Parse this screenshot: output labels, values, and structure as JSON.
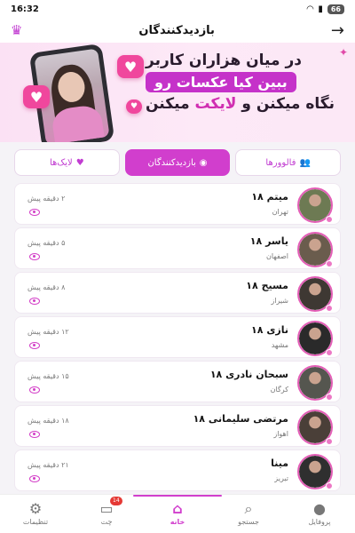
{
  "status_bar": {
    "time": "16:32",
    "battery": "66"
  },
  "app_bar": {
    "title": "بازدیدکنندگان"
  },
  "banner": {
    "line1": "در میان هزاران کاربر",
    "line2": "ببین کیا عکسات رو",
    "line3_prefix": "نگاه میکنن و",
    "line3_highlight": "لایکت",
    "line3_suffix": "میکنن"
  },
  "tabs": [
    {
      "label": "فالوورها",
      "icon": "users-icon"
    },
    {
      "label": "بازدیدکنندگان",
      "icon": "eye-icon"
    },
    {
      "label": "لایک‌ها",
      "icon": "heart-icon"
    }
  ],
  "visitors": [
    {
      "name": "میتم ۱۸",
      "city": "تهران",
      "time": "۲ دقیقه پیش",
      "avatar_color": "#6d7a53"
    },
    {
      "name": "یاسر ۱۸",
      "city": "اصفهان",
      "time": "۵ دقیقه پیش",
      "avatar_color": "#6a5c4d"
    },
    {
      "name": "مسیح ۱۸",
      "city": "شیراز",
      "time": "۸ دقیقه پیش",
      "avatar_color": "#3e3833"
    },
    {
      "name": "نازی ۱۸",
      "city": "مشهد",
      "time": "۱۲ دقیقه پیش",
      "avatar_color": "#2a2a2a"
    },
    {
      "name": "سبحان نادری ۱۸",
      "city": "کرگان",
      "time": "۱۵ دقیقه پیش",
      "avatar_color": "#55564f"
    },
    {
      "name": "مرتضی سلیمانی ۱۸",
      "city": "اهواز",
      "time": "۱۸ دقیقه پیش",
      "avatar_color": "#4a3f38"
    },
    {
      "name": "مینا",
      "city": "تبریز",
      "time": "۲۱ دقیقه پیش",
      "avatar_color": "#2f2f2f"
    }
  ],
  "bottom_nav": [
    {
      "label": "تنظیمات",
      "icon": "gear-icon"
    },
    {
      "label": "چت",
      "icon": "chat-icon",
      "badge": "14"
    },
    {
      "label": "خانه",
      "icon": "home-icon"
    },
    {
      "label": "جستجو",
      "icon": "search-icon"
    },
    {
      "label": "پروفایل",
      "icon": "person-icon"
    }
  ],
  "colors": {
    "accent": "#d13ecd",
    "banner_bg": "#fbe1f4",
    "online": "#ec78c5"
  }
}
